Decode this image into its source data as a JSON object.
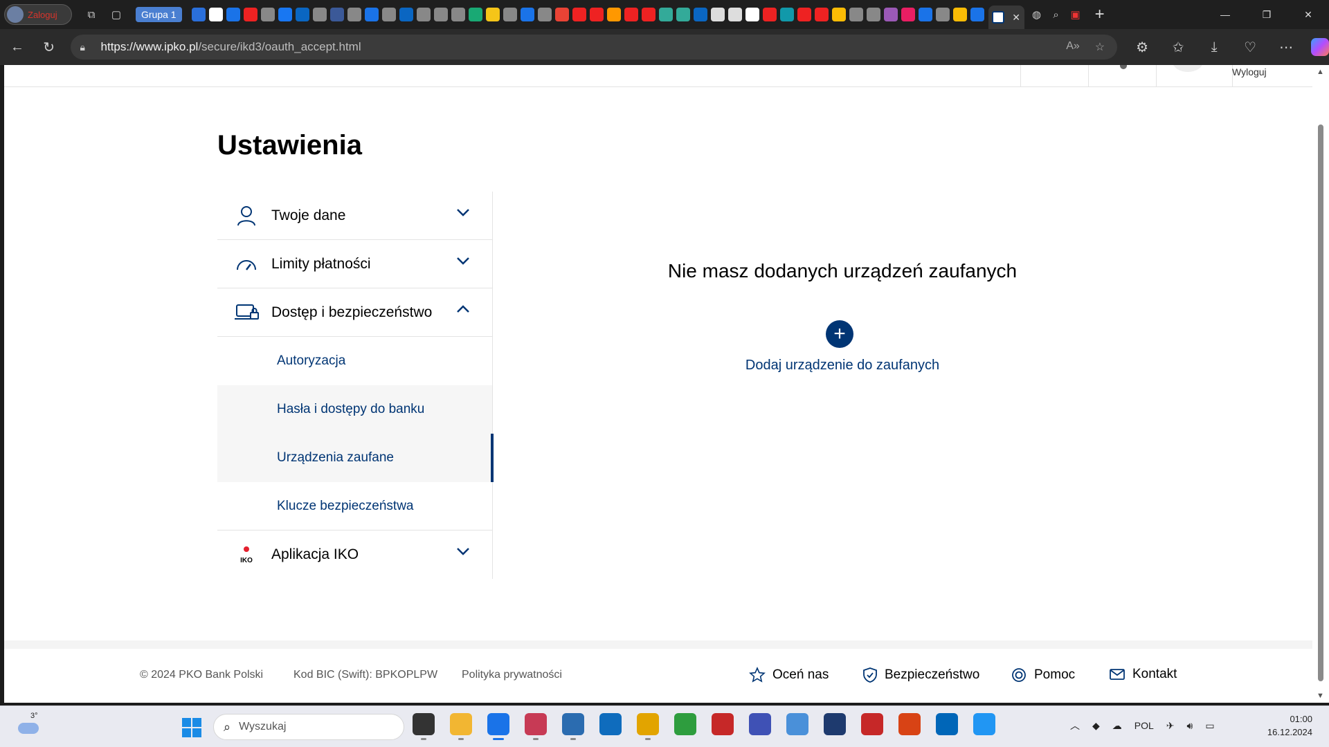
{
  "browser": {
    "profile_label": "Zaloguj",
    "tab_group_label": "Grupa 1",
    "url_host": "https://www.ipko.pl",
    "url_path": "/secure/ikd3/oauth_accept.html",
    "mini_tab_colors": [
      "#2a6fdb",
      "#ffffff",
      "#1a73e8",
      "#e22",
      "#888",
      "#1877f2",
      "#0a66c2",
      "#888",
      "#3b5998",
      "#888",
      "#1a73e8",
      "#888",
      "#0a66c2",
      "#888",
      "#888",
      "#888",
      "#19a974",
      "#f5c518",
      "#888",
      "#1a73e8",
      "#888",
      "#ea4335",
      "#e22",
      "#e22",
      "#ff9800",
      "#e22",
      "#e22",
      "#3a9",
      "#3a9",
      "#0a66c2",
      "#ddd",
      "#ddd",
      "#fff",
      "#e22",
      "#19a",
      "#e22",
      "#e22",
      "#fbbc05",
      "#888",
      "#888",
      "#9b59b6",
      "#e91e63",
      "#1a73e8",
      "#888",
      "#fbbc05",
      "#1a73e8"
    ]
  },
  "site": {
    "header_logout": "Wyloguj",
    "page_title": "Ustawienia",
    "menu": {
      "twoje_dane": "Twoje dane",
      "limity": "Limity płatności",
      "dostep": "Dostęp i bezpieczeństwo",
      "aplikacja": "Aplikacja IKO",
      "iko_badge": "IKO"
    },
    "submenu": {
      "autoryzacja": "Autoryzacja",
      "hasla": "Hasła i dostępy do banku",
      "urzadzenia": "Urządzenia zaufane",
      "klucze": "Klucze bezpieczeństwa"
    },
    "content": {
      "empty_message": "Nie masz dodanych urządzeń zaufanych",
      "add_link": "Dodaj urządzenie do zaufanych"
    },
    "footer": {
      "copyright": "© 2024 PKO Bank Polski",
      "bic": "Kod BIC (Swift): BPKOPLPW",
      "privacy": "Polityka prywatności",
      "rate": "Oceń nas",
      "security": "Bezpieczeństwo",
      "help": "Pomoc",
      "contact": "Kontakt"
    }
  },
  "taskbar": {
    "weather_temp": "3°",
    "search_placeholder": "Wyszukaj",
    "app_colors": [
      "#333333",
      "#f2b632",
      "#1a73e8",
      "#c73a55",
      "#2b6cb0",
      "#0f6cbd",
      "#e2a400",
      "#2e9d3e",
      "#c62828",
      "#3f51b5",
      "#4a90d9",
      "#1e3a6e",
      "#c62828",
      "#d84315",
      "#0066b8",
      "#2196f3"
    ],
    "language": "POL",
    "time": "01:00",
    "date": "16.12.2024",
    "colors": {
      "brand_navy": "#003574"
    }
  }
}
